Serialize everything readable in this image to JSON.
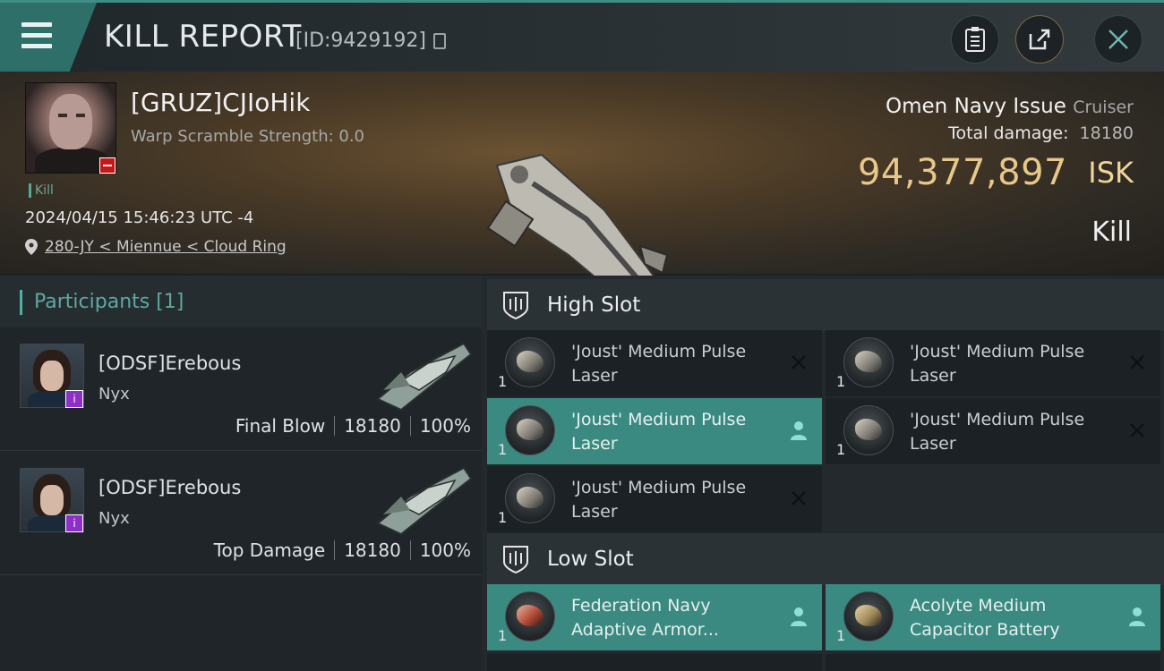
{
  "header": {
    "title": "KILL REPORT",
    "report_id": "[ID:9429192]",
    "buttons": [
      "clipboard-icon",
      "share-icon",
      "close-icon"
    ]
  },
  "victim": {
    "name": "[GRUZ]CJIoHik",
    "warp_scramble": "Warp Scramble Strength: 0.0",
    "tag": "Kill",
    "datetime": "2024/04/15 15:46:23 UTC -4",
    "location": "280-JY < Miennue < Cloud Ring"
  },
  "ship": {
    "name": "Omen Navy Issue",
    "class": "Cruiser",
    "total_damage_label": "Total damage:",
    "total_damage": "18180",
    "isk_value": "94,377,897",
    "isk_unit": "ISK",
    "result": "Kill"
  },
  "participants": {
    "title": "Participants [1]",
    "rows": [
      {
        "name": "[ODSF]Erebous",
        "ship": "Nyx",
        "role": "Final Blow",
        "damage": "18180",
        "percent": "100%"
      },
      {
        "name": "[ODSF]Erebous",
        "ship": "Nyx",
        "role": "Top Damage",
        "damage": "18180",
        "percent": "100%"
      }
    ]
  },
  "slots": {
    "high": {
      "label": "High Slot",
      "modules": [
        {
          "line1": "'Joust' Medium Pulse",
          "line2": "Laser",
          "qty": "1",
          "status": "destroyed"
        },
        {
          "line1": "'Joust' Medium Pulse",
          "line2": "Laser",
          "qty": "1",
          "status": "destroyed"
        },
        {
          "line1": "'Joust' Medium Pulse",
          "line2": "Laser",
          "qty": "1",
          "status": "dropped"
        },
        {
          "line1": "'Joust' Medium Pulse",
          "line2": "Laser",
          "qty": "1",
          "status": "destroyed"
        },
        {
          "line1": "'Joust' Medium Pulse",
          "line2": "Laser",
          "qty": "1",
          "status": "destroyed"
        }
      ]
    },
    "low": {
      "label": "Low Slot",
      "modules": [
        {
          "line1": "Federation Navy",
          "line2": "Adaptive Armor...",
          "qty": "1",
          "status": "dropped"
        },
        {
          "line1": "Acolyte Medium",
          "line2": "Capacitor Battery",
          "qty": "1",
          "status": "dropped"
        }
      ]
    }
  },
  "colors": {
    "accent_teal": "#3b8a82",
    "isk_gold": "#e7c78a",
    "badge_red": "#c4191a",
    "badge_purple": "#8e2fc9"
  }
}
